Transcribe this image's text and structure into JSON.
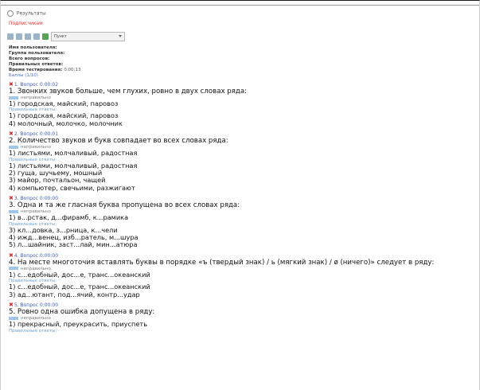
{
  "window": {
    "title": "Результаты"
  },
  "pretitle": "Подписчикам",
  "toolbar": {
    "select_value": "Пункт"
  },
  "info": {
    "user_label": "Имя пользователя:",
    "group_label": "Группа пользователя:",
    "questions_label": "Всего вопросов:",
    "correct_label": "Правильных ответов:",
    "time_label": "Время тестирования:",
    "time_value": "0:00:13",
    "score_link": "Баллы (1/10)"
  },
  "questions": [
    {
      "head": "1. Вопрос 0:00:02",
      "text_plain": "1. Звонких звуков больше, чем глухих, ровно в двух словах ряда:",
      "tag": "неправильно",
      "answers": [
        "1) городская, майский, паровоз"
      ],
      "correct_label": "Правильные ответы:",
      "correct": [
        "1) городская, майский, паровоз",
        "4) молочный, молочко, молочник"
      ]
    },
    {
      "head": "2. Вопрос 0:00:01",
      "text_plain": "2. Количество звуков и букв совпадает во всех словах ряда:",
      "tag": "неправильно",
      "answers": [
        "1) листьями, молчаливый, радостная"
      ],
      "correct_label": "Правильные ответы:",
      "correct": [
        "1) листьями, молчаливый, радостная",
        "2) гуща, шучьему, мошный",
        "3) майор, почтальон, чащей",
        "4) компьютер, свечьими, разжигают"
      ]
    },
    {
      "head": "3. Вопрос 0:00:00",
      "text_plain": "3. Одна и та же гласная буква пропущена во всех словах ряда:",
      "tag": "неправильно",
      "answers": [
        "1) в...рстак, д...фирамб, к...рамика"
      ],
      "correct_label": "Правильные ответы:",
      "correct": [
        "3) кл...довка, з...рница, к...чели",
        "4) ижд...венец, изб...ратель, м...шура",
        "5) л...шайник, заст...лай, мин...атюра"
      ]
    },
    {
      "head": "4. Вопрос 0:00:00",
      "text_plain": "4. На месте многоточия вставлять буквы в порядке «ъ (твердый знак) / ь (мягкий знак) / ø (ничего)» следует в ряду:",
      "tag": "неправильно",
      "answers": [
        "1) с...едобный, дос...е, транс...океанский"
      ],
      "correct_label": "Правильные ответы:",
      "correct": [
        "1) с...едобный, дос...е, транс...океанский",
        "3) ад...ютант, под...ячий, контр...удар"
      ]
    },
    {
      "head": "5. Вопрос 0:00:00",
      "text_plain": "5. Ровно одна ошибка допущена в ряду:",
      "tag": "неправильно",
      "answers": [
        "1) прекрасный, преукрасить, приуспеть"
      ],
      "correct_label": "Правильные ответы:",
      "correct": []
    }
  ]
}
